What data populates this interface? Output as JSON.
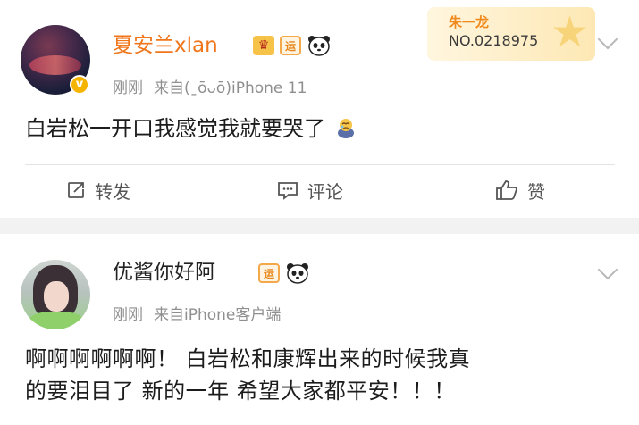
{
  "posts": [
    {
      "username": "夏安兰xlan",
      "time": "刚刚",
      "source": "来自(ˍōᴗō)iPhone 11",
      "text": "白岩松一开口我感觉我就要哭了",
      "badge_yun": "运",
      "fan_card": {
        "title": "朱一龙",
        "number": "NO.0218975"
      },
      "actions": {
        "repost": "转发",
        "comment": "评论",
        "like": "赞"
      }
    },
    {
      "username": "优酱你好阿",
      "time": "刚刚",
      "source": "来自iPhone客户端",
      "text_line1": "啊啊啊啊啊啊！ 白岩松和康辉出来的时候我真",
      "text_line2": "的要泪目了 新的一年 希望大家都平安！！！",
      "badge_yun": "运"
    }
  ],
  "colors": {
    "username_vip": "#f0761c",
    "meta": "#8f8f8f",
    "background": "#f2f2f2"
  },
  "icons": [
    "crown-vip-icon",
    "yun-badge-icon",
    "panda-icon",
    "verified-v-icon",
    "chevron-down-icon",
    "repost-icon",
    "comment-icon",
    "like-icon",
    "emoji-crying-icon"
  ]
}
